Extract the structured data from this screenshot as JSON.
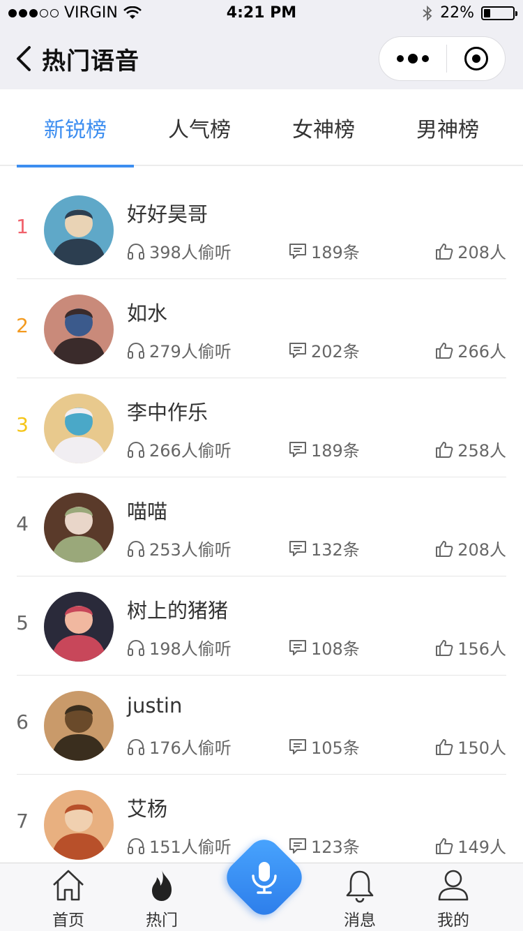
{
  "status_bar": {
    "carrier": "VIRGIN",
    "time": "4:21 PM",
    "battery": "22%",
    "battery_level": 0.22
  },
  "nav": {
    "title": "热门语音"
  },
  "tabs": [
    {
      "label": "新锐榜",
      "active": true
    },
    {
      "label": "人气榜",
      "active": false
    },
    {
      "label": "女神榜",
      "active": false
    },
    {
      "label": "男神榜",
      "active": false
    }
  ],
  "colors": {
    "accent": "#3d8ef0",
    "rank1": "#f0606a",
    "rank2": "#f39a1f",
    "rank3": "#f5c518"
  },
  "list": [
    {
      "rank": "1",
      "name": "好好昊哥",
      "listen": "398人偷听",
      "comments": "189条",
      "likes": "208人"
    },
    {
      "rank": "2",
      "name": "如水",
      "listen": "279人偷听",
      "comments": "202条",
      "likes": "266人"
    },
    {
      "rank": "3",
      "name": "李中作乐",
      "listen": "266人偷听",
      "comments": "189条",
      "likes": "258人"
    },
    {
      "rank": "4",
      "name": "喵喵",
      "listen": "253人偷听",
      "comments": "132条",
      "likes": "208人"
    },
    {
      "rank": "5",
      "name": "树上的猪猪",
      "listen": "198人偷听",
      "comments": "108条",
      "likes": "156人"
    },
    {
      "rank": "6",
      "name": "justin",
      "listen": "176人偷听",
      "comments": "105条",
      "likes": "150人"
    },
    {
      "rank": "7",
      "name": "艾杨",
      "listen": "151人偷听",
      "comments": "123条",
      "likes": "149人"
    }
  ],
  "tabbar": {
    "home": "首页",
    "hot": "热门",
    "messages": "消息",
    "mine": "我的"
  },
  "icons": [
    "wifi-icon",
    "bluetooth-icon",
    "back-arrow-icon",
    "more-icon",
    "close-mini-program-icon",
    "headphones-icon",
    "comment-icon",
    "thumbs-up-icon",
    "home-icon",
    "flame-icon",
    "microphone-icon",
    "bell-icon",
    "user-icon"
  ]
}
